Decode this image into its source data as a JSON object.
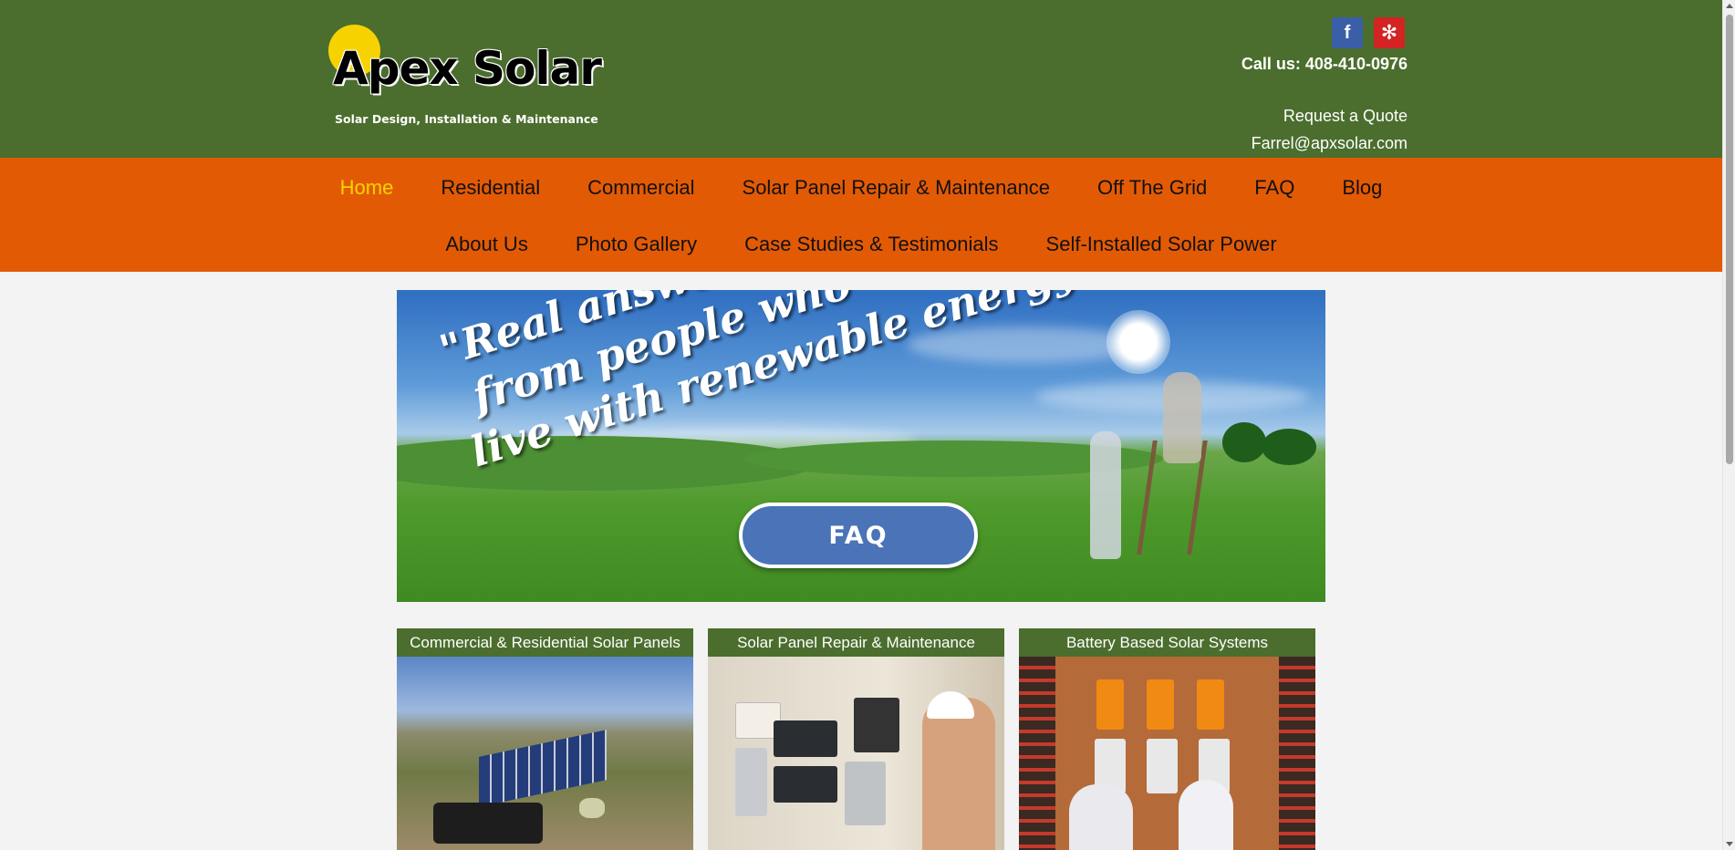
{
  "header": {
    "logo_text": "Apex Solar",
    "tagline": "Solar Design, Installation & Maintenance",
    "social": {
      "facebook_glyph": "f",
      "yelp_glyph": "✻"
    },
    "call": "Call us: 408-410-0976",
    "quote_link": "Request a Quote",
    "email_link": "Farrel@apxsolar.com"
  },
  "nav": {
    "row1": [
      "Home",
      "Residential",
      "Commercial",
      "Solar Panel Repair & Maintenance",
      "Off The Grid",
      "FAQ",
      "Blog"
    ],
    "row2": [
      "About Us",
      "Photo Gallery",
      "Case Studies & Testimonials",
      "Self-Installed Solar Power"
    ],
    "active": "Home"
  },
  "banner": {
    "slogan_line1": "\"Real answers",
    "slogan_line2": "from people who",
    "slogan_line3": "live with renewable energy\"",
    "button_label": "FAQ"
  },
  "cards": [
    {
      "title": "Commercial & Residential Solar Panels"
    },
    {
      "title": "Solar Panel Repair & Maintenance"
    },
    {
      "title": "Battery Based Solar Systems"
    }
  ],
  "colors": {
    "header_green": "#4b6e2e",
    "nav_orange": "#e35a05",
    "active_yellow": "#f6d300",
    "faq_blue": "#4a73b8",
    "facebook_blue": "#3b5ea8",
    "yelp_red": "#d32323"
  }
}
